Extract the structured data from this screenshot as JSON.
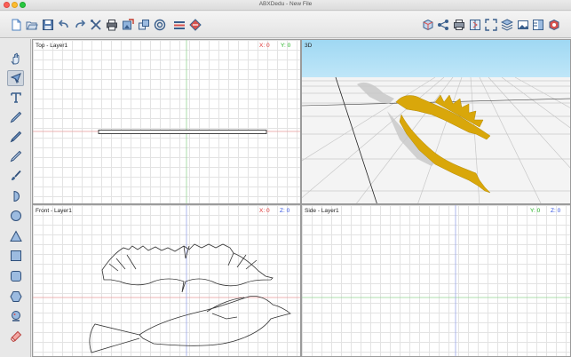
{
  "window": {
    "title": "ABXDedu - New File"
  },
  "toolbar": {
    "left_buttons": [
      {
        "icon": "new-file-icon"
      },
      {
        "icon": "open-folder-icon"
      },
      {
        "icon": "save-icon"
      },
      {
        "icon": "undo-icon"
      },
      {
        "icon": "redo-icon"
      },
      {
        "icon": "tools-icon"
      },
      {
        "icon": "print-icon"
      },
      {
        "icon": "image-import-icon"
      },
      {
        "icon": "copy-layers-icon"
      },
      {
        "icon": "target-icon"
      },
      {
        "icon": "layers-list-icon"
      },
      {
        "icon": "diamond-arrows-icon"
      }
    ],
    "right_buttons": [
      {
        "icon": "box-view-icon"
      },
      {
        "icon": "share-icon"
      },
      {
        "icon": "printer-3d-icon"
      },
      {
        "icon": "split-view-icon"
      },
      {
        "icon": "fit-view-icon"
      },
      {
        "icon": "stack-layers-icon"
      },
      {
        "icon": "picture-icon"
      },
      {
        "icon": "panels-icon"
      },
      {
        "icon": "settings-cube-icon"
      }
    ]
  },
  "sidebar": {
    "tools": [
      {
        "icon": "hand-icon"
      },
      {
        "icon": "select-arrow-icon",
        "active": true
      },
      {
        "icon": "text-tool-icon"
      },
      {
        "icon": "pen-icon"
      },
      {
        "icon": "pen-nib-icon"
      },
      {
        "icon": "pencil-icon"
      },
      {
        "icon": "brush-icon"
      },
      {
        "icon": "half-circle-icon"
      },
      {
        "icon": "circle-icon"
      },
      {
        "icon": "triangle-icon"
      },
      {
        "icon": "square-icon"
      },
      {
        "icon": "rounded-square-icon"
      },
      {
        "icon": "hexagon-icon"
      },
      {
        "icon": "stamp-icon"
      },
      {
        "icon": "eraser-icon"
      }
    ]
  },
  "viewports": {
    "top": {
      "label": "Top - Layer1",
      "x_label": "X: 0",
      "y_label": "Y: 0"
    },
    "view3d": {
      "label": "3D"
    },
    "front": {
      "label": "Front - Layer1",
      "x_label": "X: 0",
      "z_label": "Z: 0"
    },
    "side": {
      "label": "Side - Layer1",
      "y_label": "Y: 0",
      "z_label": "Z: 0"
    }
  },
  "colors": {
    "x_axis": "#e03030",
    "y_axis": "#20b020",
    "z_axis": "#3050e0",
    "sky": "#9fd8f3",
    "model": "#d9a70a"
  }
}
